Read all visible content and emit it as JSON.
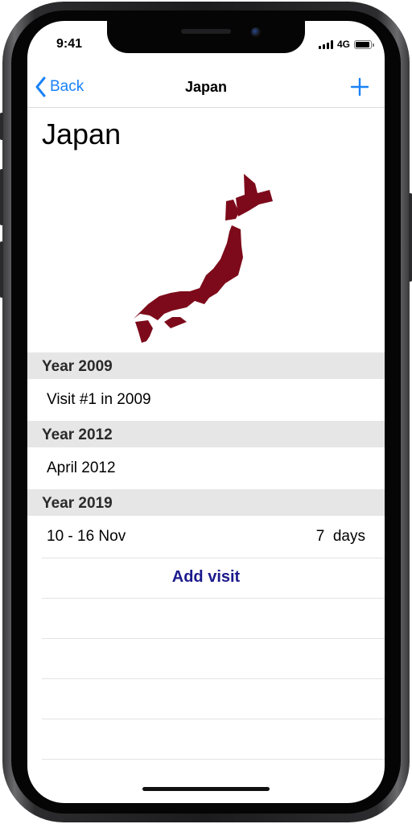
{
  "status_bar": {
    "time": "9:41",
    "network": "4G"
  },
  "nav": {
    "back_label": "Back",
    "title": "Japan",
    "add_icon": "plus-icon",
    "back_icon": "chevron-left-icon"
  },
  "page": {
    "title": "Japan",
    "map_icon": "japan-map",
    "map_color": "#7d0a1a",
    "accent_color": "#1a82f7"
  },
  "sections": [
    {
      "header": "Year 2009",
      "rows": [
        {
          "label": "Visit #1 in 2009",
          "detail": ""
        }
      ]
    },
    {
      "header": "Year 2012",
      "rows": [
        {
          "label": "April 2012",
          "detail": ""
        }
      ]
    },
    {
      "header": "Year 2019",
      "rows": [
        {
          "label": "10 - 16 Nov",
          "detail": "7  days"
        }
      ]
    }
  ],
  "add_visit_label": "Add visit"
}
